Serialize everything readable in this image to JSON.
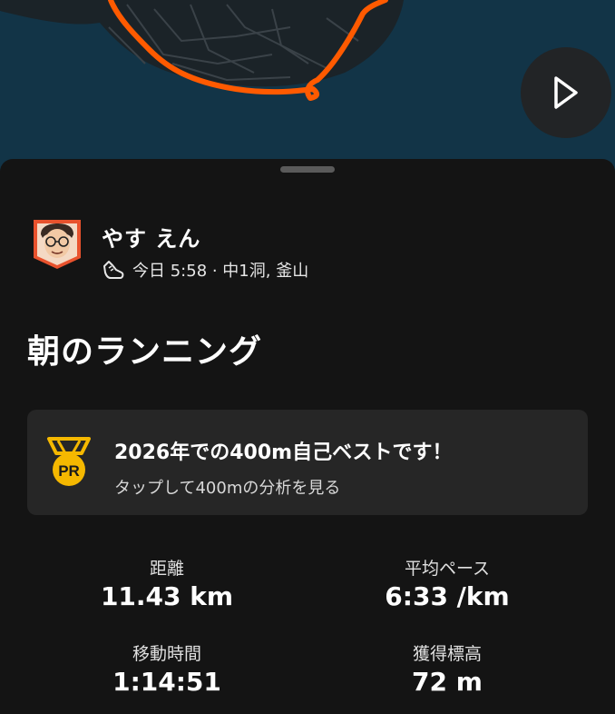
{
  "map": {
    "route_color": "#ff5a00"
  },
  "controls": {
    "play_icon": "play-icon"
  },
  "athlete": {
    "name": "やす えん",
    "activity_icon": "running-shoe-icon",
    "meta": "今日 5:58 · 中1洞, 釜山"
  },
  "activity": {
    "title": "朝のランニング"
  },
  "pr_card": {
    "badge_text": "PR",
    "badge_color": "#f5b800",
    "title": "2026年での400m自己ベストです！",
    "subtitle": "タップして400mの分析を見る"
  },
  "stats": {
    "distance": {
      "label": "距離",
      "value": "11.43 km"
    },
    "pace": {
      "label": "平均ペース",
      "value": "6:33 /km"
    },
    "moving_time": {
      "label": "移動時間",
      "value": "1:14:51"
    },
    "elevation": {
      "label": "獲得標高",
      "value": "72 m"
    }
  }
}
